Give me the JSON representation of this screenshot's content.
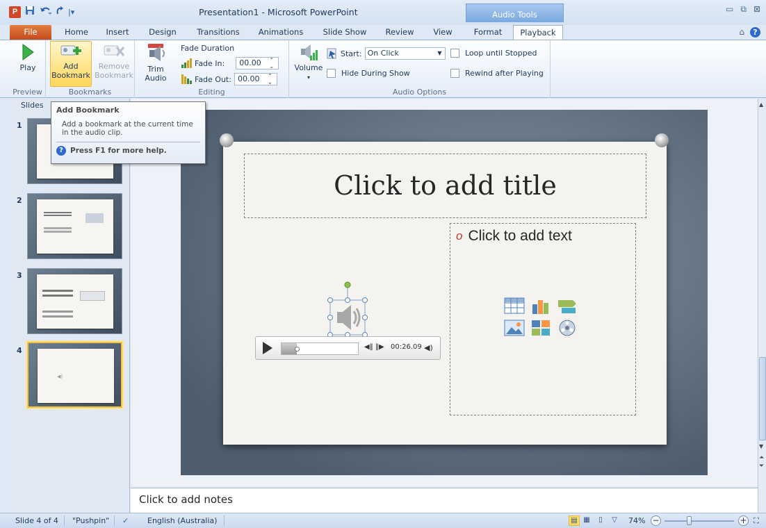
{
  "window": {
    "title": "Presentation1 - Microsoft PowerPoint",
    "app_icon_letter": "P",
    "contextual_header": "Audio Tools"
  },
  "tabs": [
    "File",
    "Home",
    "Insert",
    "Design",
    "Transitions",
    "Animations",
    "Slide Show",
    "Review",
    "View",
    "Format",
    "Playback"
  ],
  "active_tab": "Playback",
  "ribbon": {
    "preview": {
      "play_label": "Play",
      "group_label": "Preview"
    },
    "bookmarks": {
      "add_label_1": "Add",
      "add_label_2": "Bookmark",
      "remove_label_1": "Remove",
      "remove_label_2": "Bookmark",
      "group_label": "Bookmarks"
    },
    "editing": {
      "trim_label_1": "Trim",
      "trim_label_2": "Audio",
      "fade_duration_label": "Fade Duration",
      "fade_in_label": "Fade In:",
      "fade_in_value": "00.00",
      "fade_out_label": "Fade Out:",
      "fade_out_value": "00.00",
      "group_label": "Editing"
    },
    "audio_options": {
      "volume_label": "Volume",
      "start_label": "Start:",
      "start_value": "On Click",
      "hide_label": "Hide During Show",
      "loop_label": "Loop until Stopped",
      "rewind_label": "Rewind after Playing",
      "group_label": "Audio Options"
    }
  },
  "slides_pane": {
    "tab_label": "Slides",
    "thumbnails": [
      {
        "number": "1"
      },
      {
        "number": "2"
      },
      {
        "number": "3"
      },
      {
        "number": "4"
      }
    ]
  },
  "tooltip": {
    "title": "Add Bookmark",
    "body": "Add a bookmark at the current time in the audio clip.",
    "help": "Press F1 for more help."
  },
  "slide": {
    "title_placeholder": "Click to add title",
    "text_placeholder": "Click to add text",
    "player_time": "00:26.09",
    "player_progress": 0.2
  },
  "notes": {
    "placeholder": "Click to add notes"
  },
  "statusbar": {
    "slide_info": "Slide 4 of 4",
    "theme": "\"Pushpin\"",
    "language": "English (Australia)",
    "zoom": "74%"
  },
  "colors": {
    "file_tab": "#d24726",
    "context_tab": "#7aa9e0",
    "selection_outline": "#f5c342"
  }
}
